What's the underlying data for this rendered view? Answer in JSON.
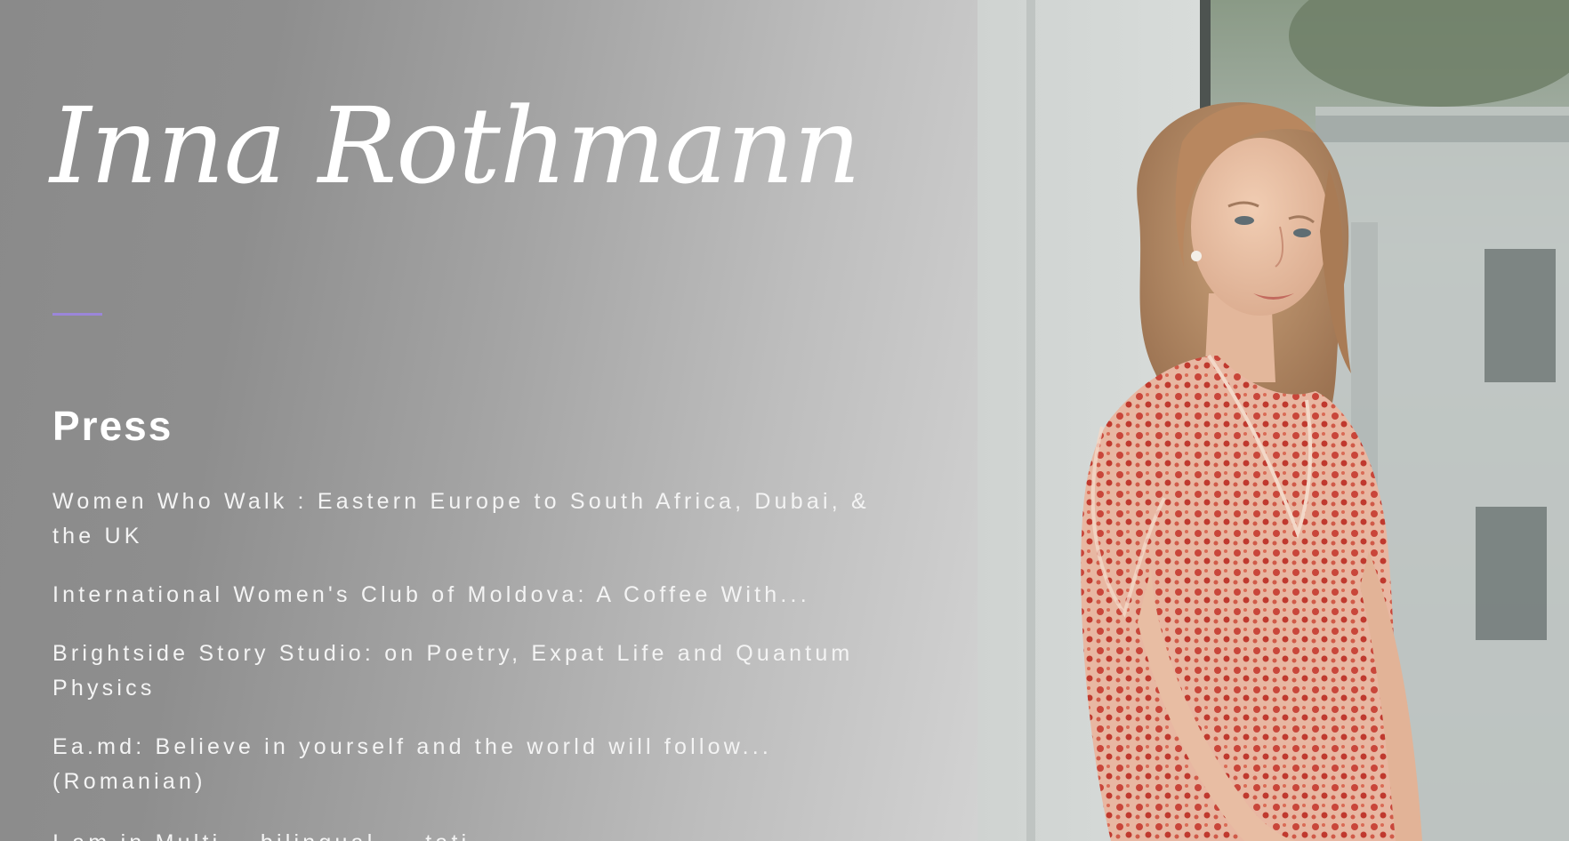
{
  "site": {
    "title": "Inna Rothmann"
  },
  "colors": {
    "accent": "#9b86d9",
    "text": "#ffffff"
  },
  "press": {
    "heading": "Press",
    "items": [
      {
        "label": "Women Who Walk : Eastern Europe to South Africa, Dubai, & the UK"
      },
      {
        "label": "International Women's Club of Moldova: A Coffee With..."
      },
      {
        "label": "Brightside Story Studio: on Poetry, Expat Life and Quantum Physics"
      },
      {
        "label": "Ea.md: Believe in yourself and the world will follow... (Romanian)"
      },
      {
        "label": "I am in Multi... bilingual ... tati..."
      }
    ]
  },
  "photo": {
    "subject": "portrait of a woman in a red floral dress leaning against a window frame"
  }
}
